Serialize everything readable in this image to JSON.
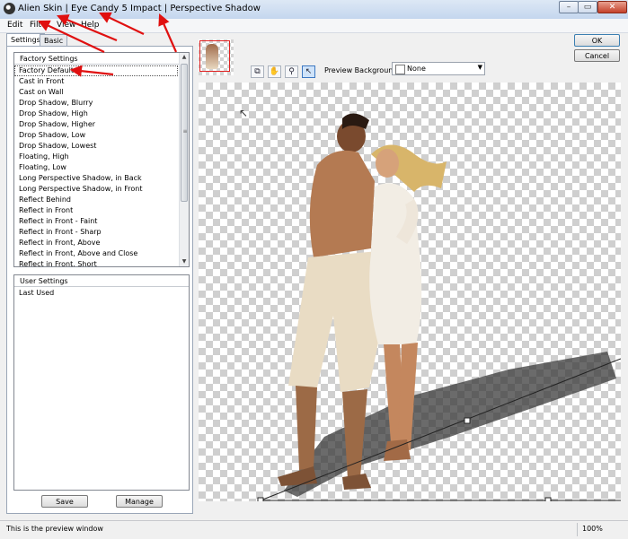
{
  "window": {
    "title": "Alien Skin | Eye Candy 5 Impact | Perspective Shadow",
    "controls": {
      "minimize": "–",
      "maximize": "▭",
      "close": "✕"
    }
  },
  "menu": [
    "Edit",
    "Filter",
    "View",
    "Help"
  ],
  "tabs": {
    "settings": "Settings",
    "basic": "Basic"
  },
  "factory_settings": {
    "header": "Factory Settings",
    "selected": "Factory Default",
    "items": [
      "Factory Default",
      "Cast in Front",
      "Cast on Wall",
      "Drop Shadow, Blurry",
      "Drop Shadow, High",
      "Drop Shadow, Higher",
      "Drop Shadow, Low",
      "Drop Shadow, Lowest",
      "Floating, High",
      "Floating, Low",
      "Long Perspective Shadow, in Back",
      "Long Perspective Shadow, in Front",
      "Reflect Behind",
      "Reflect in Front",
      "Reflect in Front - Faint",
      "Reflect in Front - Sharp",
      "Reflect in Front, Above",
      "Reflect in Front, Above and Close",
      "Reflect in Front, Short"
    ]
  },
  "user_settings": {
    "header": "User Settings",
    "items": [
      "Last Used"
    ]
  },
  "buttons": {
    "save": "Save",
    "manage": "Manage",
    "ok": "OK",
    "cancel": "Cancel"
  },
  "preview": {
    "background_label": "Preview Background:",
    "background_value": "None",
    "tools": [
      "preview-compare-icon",
      "hand-icon",
      "zoom-icon",
      "pointer-icon"
    ]
  },
  "status": {
    "text": "This is the preview window",
    "zoom": "100%"
  },
  "colors": {
    "annotation_arrow": "#e01010",
    "selection_frame": "#e02020",
    "ok_border": "#3c7fb1"
  }
}
